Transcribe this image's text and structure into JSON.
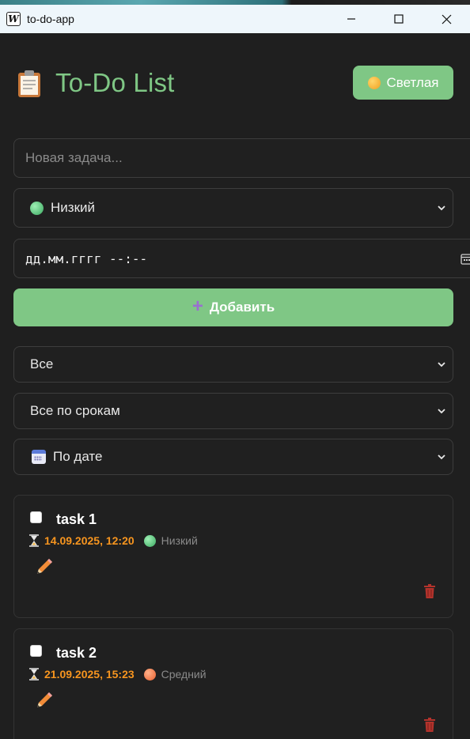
{
  "window": {
    "title": "to-do-app",
    "icon_letter": "W",
    "minimize_glyph": "—",
    "close_glyph": "✕"
  },
  "header": {
    "title": "To-Do List",
    "logo_icon": "clipboard-icon",
    "theme_button_label": "Светлая",
    "theme_button_icon": "sun-icon"
  },
  "form": {
    "task_placeholder": "Новая задача...",
    "priority_selected": "Низкий",
    "date_placeholder": "дд.мм.гггг --:--",
    "add_button_icon": "+",
    "add_button_label": "Добавить"
  },
  "filters": {
    "status_selected": "Все",
    "deadline_selected": "Все по срокам",
    "sort_selected": "По дате",
    "sort_icon": "calendar-icon"
  },
  "tasks": [
    {
      "title": "task 1",
      "deadline": "14.09.2025, 12:20",
      "priority": "Низкий",
      "priority_color": "#3aa860",
      "completed": false
    },
    {
      "title": "task 2",
      "deadline": "21.09.2025, 15:23",
      "priority": "Средний",
      "priority_color": "#e8602f",
      "completed": false
    }
  ],
  "colors": {
    "accent": "#7fc785",
    "background": "#1f1f1f",
    "deadline": "#f7951f",
    "delete": "#c0392b"
  }
}
